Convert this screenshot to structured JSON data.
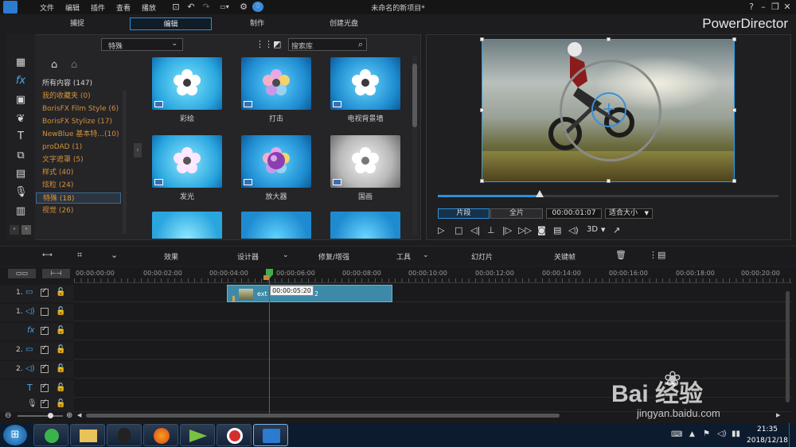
{
  "window": {
    "title": "未命名的新项目*",
    "brand": "PowerDirector"
  },
  "menu": {
    "items": [
      "文件",
      "编辑",
      "插件",
      "查看",
      "播放"
    ]
  },
  "modes": {
    "tabs": [
      "捕捉",
      "编辑",
      "制作",
      "创建光盘"
    ],
    "active": "编辑"
  },
  "library": {
    "filter_value": "特殊",
    "search_placeholder": "搜索库",
    "categories": [
      {
        "label": "所有内容 (147)"
      },
      {
        "label": "我的收藏夹 (0)"
      },
      {
        "label": "BorisFX Film Style (6)"
      },
      {
        "label": "BorisFX Stylize (17)"
      },
      {
        "label": "NewBlue 基本特...(10)"
      },
      {
        "label": "proDAD (1)"
      },
      {
        "label": "文字遮罩 (5)"
      },
      {
        "label": "样式 (40)"
      },
      {
        "label": "炫粒 (24)"
      },
      {
        "label": "特殊 (18)"
      },
      {
        "label": "视觉 (26)"
      }
    ],
    "effects": [
      {
        "label": "彩绘"
      },
      {
        "label": "打击"
      },
      {
        "label": "电视背景墙"
      },
      {
        "label": "发光"
      },
      {
        "label": "放大器"
      },
      {
        "label": "国画"
      }
    ]
  },
  "preview": {
    "mode_clip": "片段",
    "mode_movie": "全片",
    "timecode": "00:00:01:07",
    "fit": "适合大小",
    "three_d": "3D",
    "progress": 0.3
  },
  "toolbar": {
    "effects": "效果",
    "designer": "设计器",
    "fix": "修复/增强",
    "tools": "工具",
    "slideshow": "幻灯片",
    "keyframe": "关键帧"
  },
  "timeline": {
    "ruler": [
      "00:00:00:00",
      "00:00:02:00",
      "00:00:04:00",
      "00:00:06:00",
      "00:00:08:00",
      "00:00:10:00",
      "00:00:12:00",
      "00:00:14:00",
      "00:00:16:00",
      "00:00:18:00",
      "00:00:20:00"
    ],
    "tooltip": "00:00:05:20",
    "clip_prefix": "ext",
    "clip_suffix": "2",
    "tracks": [
      {
        "num": "1.",
        "icon": "video-track-icon"
      },
      {
        "num": "1.",
        "icon": "audio-track-icon"
      },
      {
        "num": "",
        "icon": "fx-track-icon"
      },
      {
        "num": "2.",
        "icon": "video-track-icon"
      },
      {
        "num": "2.",
        "icon": "audio-track-icon"
      },
      {
        "num": "",
        "icon": "title-track-icon"
      },
      {
        "num": "",
        "icon": "voice-track-icon"
      }
    ]
  },
  "taskbar": {
    "time": "21:35",
    "date": "2018/12/18"
  },
  "watermark": {
    "brand": "Bai 经验",
    "url": "jingyan.baidu.com"
  }
}
